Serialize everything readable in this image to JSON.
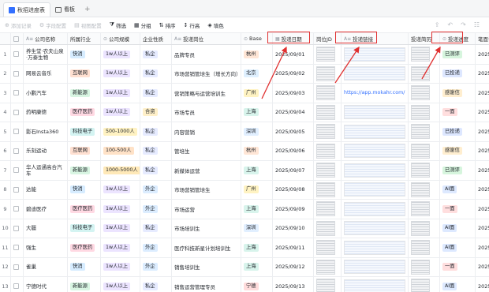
{
  "tabs": [
    {
      "label": "秋招进度表"
    },
    {
      "label": "看板"
    }
  ],
  "toolbar": {
    "add_record": "添加记录",
    "fields": "字段配置",
    "view": "视图配置",
    "filter": "筛选",
    "group": "分组",
    "sort": "排序",
    "row_height": "行高",
    "fill": "填色"
  },
  "columns": [
    "公司名称",
    "所属行业",
    "公司规模",
    "企业性质",
    "投递岗位",
    "Base",
    "投递日期",
    "岗位JD",
    "投递链接",
    "投递简历",
    "投递进度",
    "笔面试"
  ],
  "rows": [
    {
      "n": "1",
      "company": "养生堂·农夫山泉·万泰生物",
      "industry": "快消",
      "size": "1w人以上",
      "nature": "私企",
      "position": "品牌专员",
      "base": "杭州",
      "date": "2025/09/01",
      "link": "",
      "progress": "已测评",
      "interview": "2025/0"
    },
    {
      "n": "2",
      "company": "网易云音乐",
      "industry": "互联网",
      "size": "1w人以上",
      "nature": "私企",
      "position": "市场营销管培生（增长方向）",
      "base": "北京",
      "date": "2025/09/02",
      "link": "",
      "progress": "已投递",
      "interview": "2025/0"
    },
    {
      "n": "3",
      "company": "小鹏汽车",
      "industry": "新能源",
      "size": "1w人以上",
      "nature": "私企",
      "position": "营销策略与运营培训生",
      "base": "广州",
      "date": "2025/09/03",
      "link": "https://app.mokahr.com/",
      "progress": "感谢信",
      "interview": "2025/0"
    },
    {
      "n": "4",
      "company": "药明康德",
      "industry": "医疗医药",
      "size": "1w人以上",
      "nature": "合资",
      "position": "市场专员",
      "base": "上海",
      "date": "2025/09/04",
      "link": "",
      "progress": "一面",
      "interview": "2025/0"
    },
    {
      "n": "5",
      "company": "影石Insta360",
      "industry": "科技电子",
      "size": "500-1000人",
      "nature": "私企",
      "position": "内容营销",
      "base": "深圳",
      "date": "2025/09/05",
      "link": "",
      "progress": "已投递",
      "interview": "2025/0"
    },
    {
      "n": "6",
      "company": "乐刻运动",
      "industry": "互联网",
      "size": "100-500人",
      "nature": "私企",
      "position": "管培生",
      "base": "杭州",
      "date": "2025/09/06",
      "link": "",
      "progress": "感谢信",
      "interview": "2025/0"
    },
    {
      "n": "7",
      "company": "华人运通高合汽车",
      "industry": "新能源",
      "size": "1000-5000人",
      "nature": "私企",
      "position": "新媒体运营",
      "base": "上海",
      "date": "2025/09/07",
      "link": "",
      "progress": "已测评",
      "interview": "2025/0"
    },
    {
      "n": "8",
      "company": "达能",
      "industry": "快消",
      "size": "1w人以上",
      "nature": "外企",
      "position": "市场营销管培生",
      "base": "广州",
      "date": "2025/09/08",
      "link": "",
      "progress": "AI面",
      "interview": "2025/0"
    },
    {
      "n": "9",
      "company": "碧迪医疗",
      "industry": "医疗医药",
      "size": "1w人以上",
      "nature": "外企",
      "position": "市场运营",
      "base": "上海",
      "date": "2025/09/09",
      "link": "",
      "progress": "一面",
      "interview": "2025/0"
    },
    {
      "n": "10",
      "company": "大疆",
      "industry": "科技电子",
      "size": "1w人以上",
      "nature": "私企",
      "position": "市场培训生",
      "base": "深圳",
      "date": "2025/09/10",
      "link": "",
      "progress": "AI面",
      "interview": "2025/0"
    },
    {
      "n": "11",
      "company": "强生",
      "industry": "医疗医药",
      "size": "1w人以上",
      "nature": "外企",
      "position": "医疗科技新星计划培训生",
      "base": "上海",
      "date": "2025/09/11",
      "link": "",
      "progress": "AI面",
      "interview": "2025/0"
    },
    {
      "n": "12",
      "company": "雀巢",
      "industry": "快消",
      "size": "1w人以上",
      "nature": "外企",
      "position": "销售培训生",
      "base": "上海",
      "date": "2025/09/12",
      "link": "",
      "progress": "一面",
      "interview": "2025/0"
    },
    {
      "n": "13",
      "company": "宁德时代",
      "industry": "新能源",
      "size": "1w人以上",
      "nature": "私企",
      "position": "销售运营管理专员",
      "base": "宁德",
      "date": "2025/09/13",
      "link": "",
      "progress": "AI面",
      "interview": "2025/0"
    }
  ],
  "colors": {
    "industry": {
      "快消": "#d6ecff",
      "互联网": "#ffe0d1",
      "新能源": "#d8f5e2",
      "医疗医药": "#ffd9e3",
      "科技电子": "#d4f4f2"
    },
    "size": {
      "1w人以上": "#ece4ff",
      "500-1000人": "#fff2c2",
      "100-500人": "#ffe2c7",
      "1000-5000人": "#ffe9b8"
    },
    "nature": {
      "私企": "#e6ebff",
      "合资": "#fff0c9",
      "外企": "#dcedff"
    },
    "base": {
      "杭州": "#ffe6d6",
      "北京": "#dff0ff",
      "广州": "#fff3c2",
      "上海": "#d8f4ec",
      "深圳": "#e1efff",
      "宁德": "#ffdcdc"
    },
    "progress": {
      "已测评": "#d6f5dd",
      "已投递": "#dde7ff",
      "感谢信": "#ffeecf",
      "一面": "#ffdede",
      "AI面": "#dde9ff"
    },
    "highlight": "#e03030"
  }
}
